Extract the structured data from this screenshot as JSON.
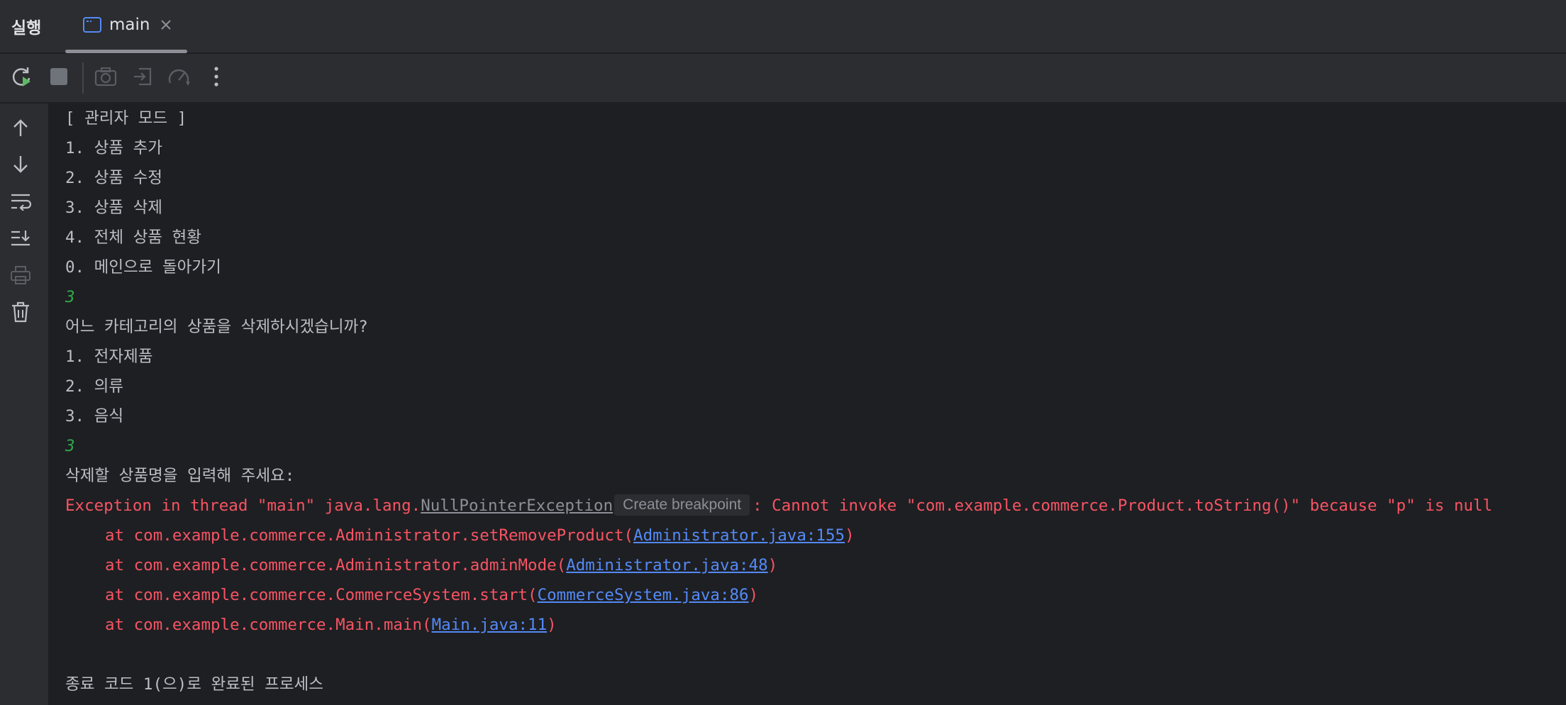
{
  "tabbar": {
    "title": "실행",
    "tab_label": "main"
  },
  "toolbar": {
    "buttons": [
      "rerun-icon",
      "stop-icon",
      "camera-icon",
      "restore-layout-icon",
      "profiler-icon",
      "more-icon"
    ]
  },
  "sidebar": {
    "buttons": [
      "arrow-up-icon",
      "arrow-down-icon",
      "soft-wrap-icon",
      "scroll-to-end-icon",
      "print-icon",
      "trash-icon"
    ]
  },
  "console": {
    "menu_header": "[ 관리자 모드 ]",
    "menu_items": [
      "1. 상품 추가",
      "2. 상품 수정",
      "3. 상품 삭제",
      "4. 전체 상품 현황",
      "0. 메인으로 돌아가기"
    ],
    "input_1": "3",
    "category_prompt": "어느 카테고리의 상품을 삭제하시겠습니까?",
    "category_items": [
      "1. 전자제품",
      "2. 의류",
      "3. 음식"
    ],
    "input_2": "3",
    "name_prompt": "삭제할 상품명을 입력해 주세요:",
    "exception": {
      "prefix": "Exception in thread \"main\" java.lang.",
      "class_name": "NullPointerException",
      "breakpoint_hint": "Create breakpoint",
      "message": ": Cannot invoke \"com.example.commerce.Product.toString()\" because \"p\" is null"
    },
    "stack": [
      {
        "at": "at com.example.commerce.Administrator.setRemoveProduct(",
        "link": "Administrator.java:155",
        "close": ")"
      },
      {
        "at": "at com.example.commerce.Administrator.adminMode(",
        "link": "Administrator.java:48",
        "close": ")"
      },
      {
        "at": "at com.example.commerce.CommerceSystem.start(",
        "link": "CommerceSystem.java:86",
        "close": ")"
      },
      {
        "at": "at com.example.commerce.Main.main(",
        "link": "Main.java:11",
        "close": ")"
      }
    ],
    "exit_message": "종료 코드 1(으)로 완료된 프로세스"
  },
  "colors": {
    "background": "#1e1f22",
    "panel": "#2b2d30",
    "text": "#bcbec4",
    "input": "#2ea84a",
    "error": "#f75464",
    "link": "#548af7"
  }
}
